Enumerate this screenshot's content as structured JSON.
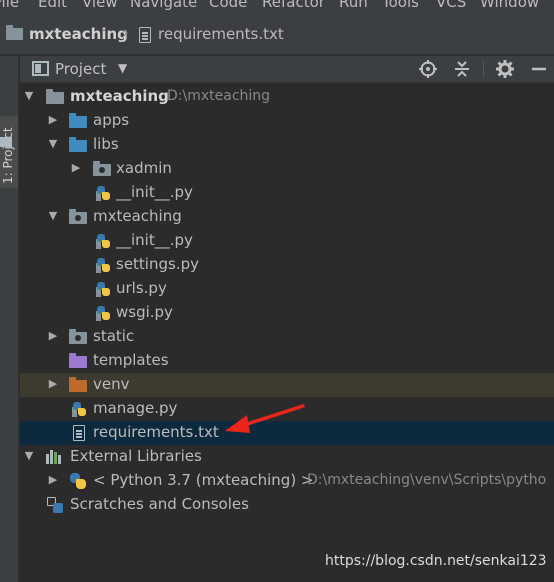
{
  "menu": {
    "items": [
      "File",
      "Edit",
      "View",
      "Navigate",
      "Code",
      "Refactor",
      "Run",
      "Tools",
      "VCS",
      "Window"
    ]
  },
  "breadcrumb": {
    "project": "mxteaching",
    "file": "requirements.txt"
  },
  "left_strip": {
    "tab_label": "1: Project"
  },
  "project_panel": {
    "title": "Project",
    "dropdown_icon": "chevron-down-icon",
    "tools": [
      "locate-icon",
      "collapse-all-icon",
      "gear-icon",
      "minimize-icon"
    ]
  },
  "tree": {
    "root_name": "mxteaching",
    "root_path": "D:\\mxteaching",
    "items": [
      {
        "label": "apps"
      },
      {
        "label": "libs"
      },
      {
        "label": "xadmin"
      },
      {
        "label": "__init__.py"
      },
      {
        "label": "mxteaching"
      },
      {
        "label": "__init__.py"
      },
      {
        "label": "settings.py"
      },
      {
        "label": "urls.py"
      },
      {
        "label": "wsgi.py"
      },
      {
        "label": "static"
      },
      {
        "label": "templates"
      },
      {
        "label": "venv"
      },
      {
        "label": "manage.py"
      },
      {
        "label": "requirements.txt"
      }
    ],
    "external_libraries": "External Libraries",
    "python_sdk": "< Python 3.7 (mxteaching) >",
    "python_sdk_path": "D:\\mxteaching\\venv\\Scripts\\pytho",
    "scratches": "Scratches and Consoles"
  },
  "colors": {
    "accent_arrow": "#e8261c",
    "selected_row": "#0d293e",
    "venv_row": "#3d3a2f"
  },
  "watermark": "https://blog.csdn.net/senkai123"
}
